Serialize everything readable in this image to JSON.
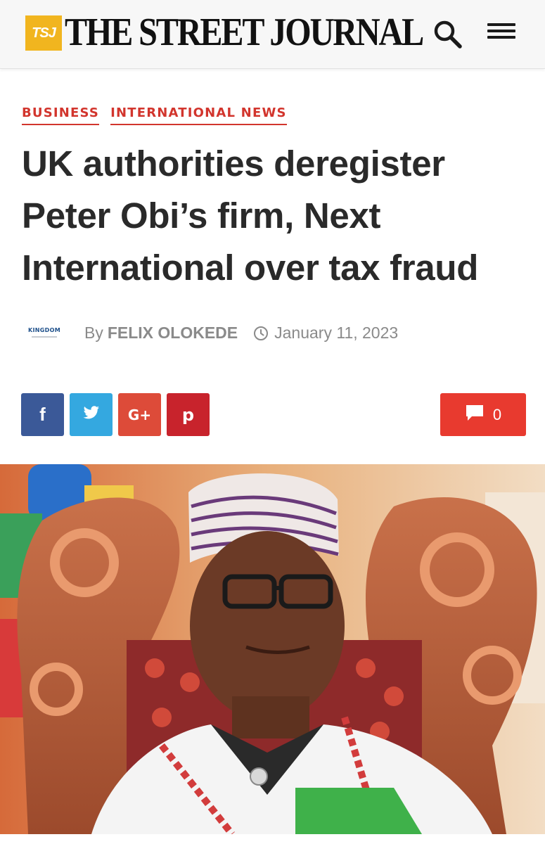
{
  "header": {
    "logo_badge": "TSJ",
    "logo_text": "THE STREET JOURNAL",
    "search_icon": "search-icon",
    "menu_icon": "hamburger-menu-icon"
  },
  "categories": [
    "BUSINESS",
    "INTERNATIONAL NEWS"
  ],
  "headline": "UK authorities deregister Peter Obi’s firm, Next International over tax fraud",
  "byline": {
    "avatar_text": "KINGDOM",
    "by_label": "By",
    "author": "FELIX OLOKEDE",
    "date_icon": "clock-icon",
    "date": "January 11, 2023"
  },
  "share": {
    "facebook": "f",
    "twitter_icon": "twitter-bird-icon",
    "googleplus": "G+",
    "pinterest": "p",
    "comment_icon": "speech-bubble-icon",
    "comment_count": "0"
  },
  "colors": {
    "accent": "#d2352d",
    "logo_badge": "#f1b51f",
    "facebook": "#3b5998",
    "twitter": "#34a8e0",
    "googleplus": "#dd4b39",
    "pinterest": "#c8232c",
    "comment": "#e83a2f"
  }
}
